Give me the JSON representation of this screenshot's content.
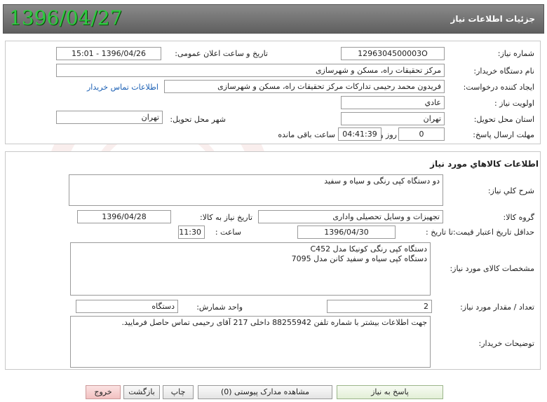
{
  "header": {
    "title": "جزئیات اطلاعات نیاز",
    "date": "1396/04/27"
  },
  "info": {
    "need_number_label": "شماره نیاز:",
    "need_number": "1296304500003O",
    "announce_label": "تاریخ و ساعت اعلان عمومی:",
    "announce_value": "1396/04/26 - 15:01",
    "buyer_org_label": "نام دستگاه خریدار:",
    "buyer_org": "مرکز تحقیقات راه، مسکن و شهرسازی",
    "requester_label": "ایجاد کننده درخواست:",
    "requester": "فریدون محمد رحیمی تدارکات مرکز تحقیقات راه، مسکن و شهرسازی",
    "contact_link": "اطلاعات تماس خریدار",
    "priority_label": "اولویت نیاز :",
    "priority": "عادي",
    "province_label": "استان محل تحویل:",
    "province": "تهران",
    "city_label": "شهر محل تحویل:",
    "city": "تهران",
    "deadline_label": "مهلت ارسال پاسخ:",
    "deadline_days": "0",
    "days_label": "روز و",
    "deadline_time": "04:41:39",
    "remaining_label": "ساعت باقی مانده"
  },
  "goods": {
    "section_title": "اطلاعات کالاهاي مورد نياز",
    "summary_label": "شرح کلي نياز:",
    "summary": "دو دستگاه کپی رنگی و سیاه و سفید",
    "group_label": "گروه کالا:",
    "group": "تجهیزات و وسایل تحصیلی واداری",
    "need_date_label": "تاریخ نیاز به کالا:",
    "need_date": "1396/04/28",
    "validity_label": "حداقل تاريخ اعتبار قيمت:",
    "to_date_label": "تا تاریخ :",
    "to_date": "1396/04/30",
    "time_label": "ساعت :",
    "time": "11:30",
    "specs_label": "مشخصات کالای مورد نیاز:",
    "specs_line1": "دستگاه کپی رنگی کونیکا مدل C452",
    "specs_line2": "دستگاه کپی سیاه و سفید کانن مدل 7095",
    "quantity_label": "تعداد / مقدار مورد نیاز:",
    "quantity": "2",
    "unit_label": "واحد شمارش:",
    "unit": "دستگاه",
    "buyer_notes_label": "توضیحات خریدار:",
    "buyer_notes": "جهت اطلاعات بیشتر با شماره تلفن 88255942 داخلی 217 آقای رحیمی تماس حاصل فرمایید."
  },
  "buttons": {
    "respond": "پاسخ به نیاز",
    "attachments": "مشاهده مدارک پیوستی (0)",
    "print": "چاپ",
    "back": "بازگشت",
    "exit": "خروج"
  }
}
